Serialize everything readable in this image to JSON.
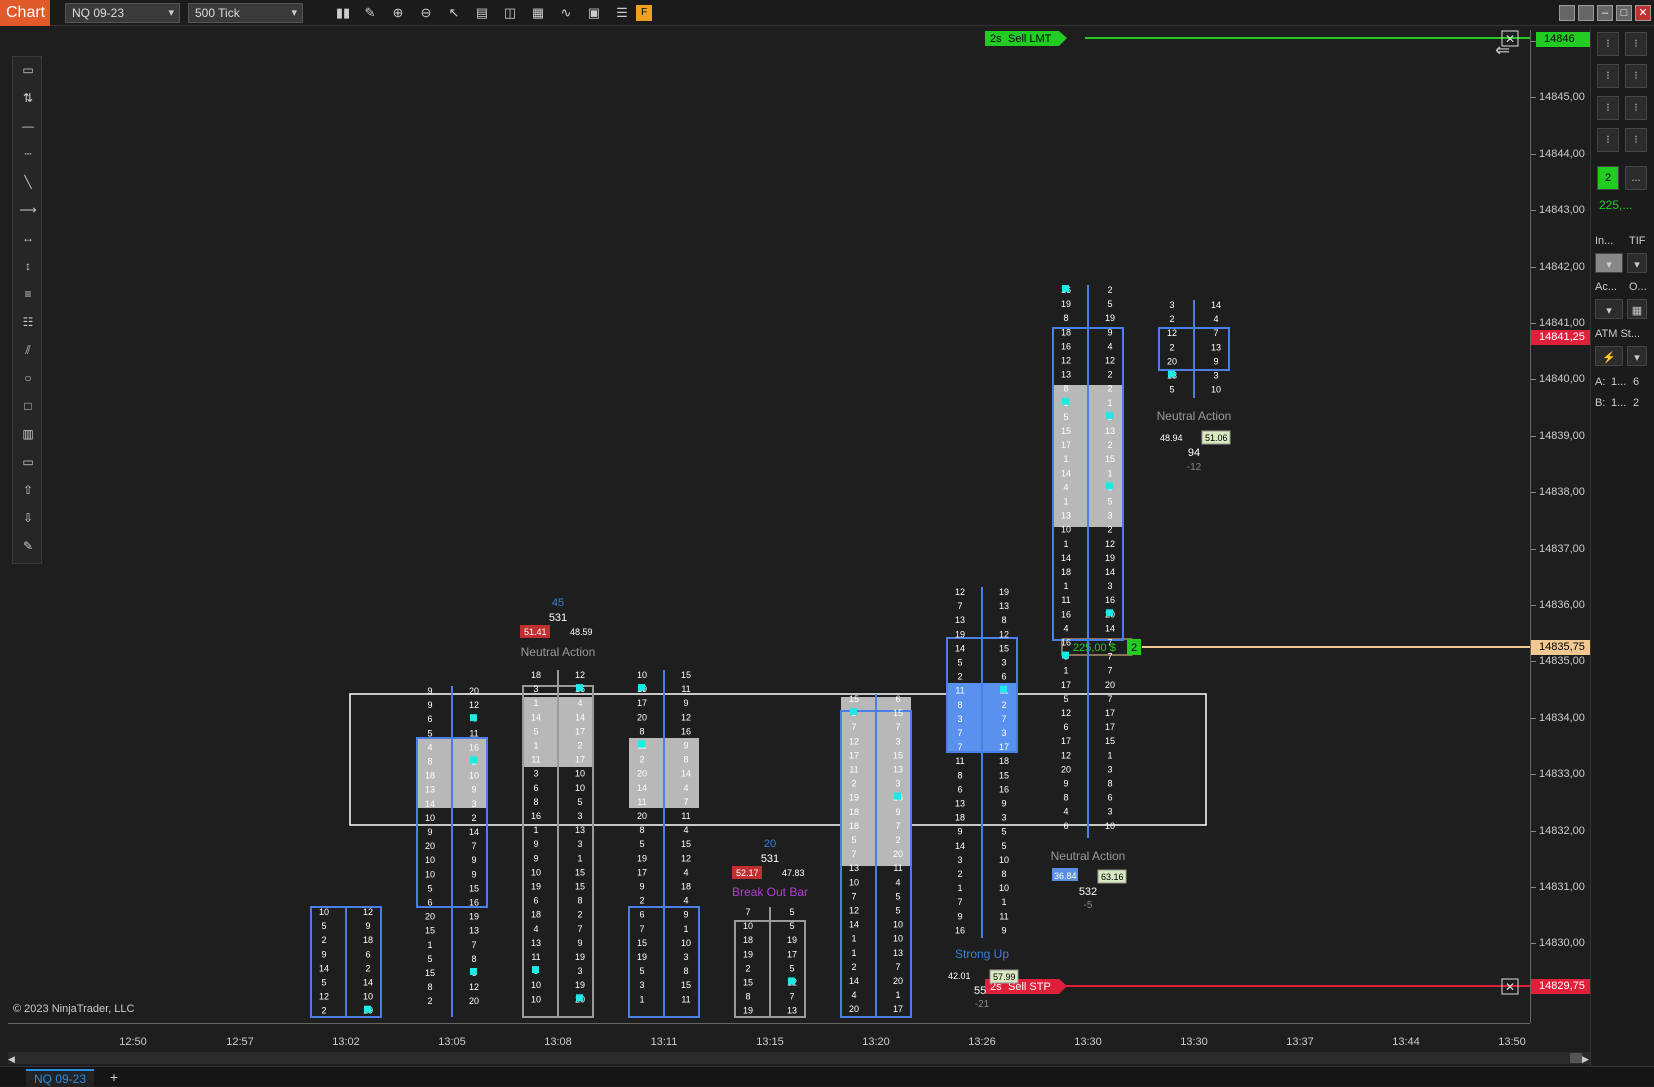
{
  "app": {
    "title": "Chart"
  },
  "toolbar": {
    "instrument": "NQ 09-23",
    "interval": "500 Tick",
    "icons": [
      "bar-type-icon",
      "pencil-icon",
      "zoom-in-icon",
      "zoom-out-icon",
      "pointer-icon",
      "data-box-icon",
      "properties-icon",
      "strategies-icon",
      "indicators-icon",
      "chart-trader-icon",
      "list-icon",
      "f-icon"
    ],
    "f_label": "F"
  },
  "window_controls": [
    "restore-icon",
    "tile-icon",
    "minimize-icon",
    "maximize-icon",
    "close-icon"
  ],
  "drawing_tools": [
    "ruler-icon",
    "risk-reward-icon",
    "line-icon",
    "ray-icon",
    "extended-line-icon",
    "arrow-line-icon",
    "horizontal-line-icon",
    "vertical-line-icon",
    "fibonacci-icon",
    "fibonacci-extension-icon",
    "channel-icon",
    "ellipse-icon",
    "rectangle-icon",
    "region-icon",
    "text-icon",
    "arrow-up-icon",
    "arrow-down-icon",
    "pencil-icon"
  ],
  "price_axis": {
    "labels": [
      "14846,00",
      "14845,00",
      "14844,00",
      "14843,00",
      "14842,00",
      "14841,00",
      "14840,00",
      "14839,00",
      "14838,00",
      "14837,00",
      "14836,00",
      "14835,00",
      "14834,00",
      "14833,00",
      "14832,00",
      "14831,00",
      "14830,00"
    ],
    "marker_top": "14846",
    "marker_red": "14841,25",
    "marker_last": "14835,75",
    "marker_bottom": "14829,75"
  },
  "time_axis": {
    "labels": [
      "12:50",
      "12:57",
      "13:02",
      "13:05",
      "13:08",
      "13:11",
      "13:15",
      "13:20",
      "13:26",
      "13:30",
      "13:30",
      "13:37",
      "13:44",
      "13:50"
    ]
  },
  "orders": {
    "sell_limit": {
      "qty": "2s",
      "label": "Sell LMT"
    },
    "sell_stop": {
      "qty": "2s",
      "label": "Sell STP"
    },
    "position_pnl": "225,00 $",
    "position_qty": "2"
  },
  "annotations": {
    "neutral_1": "Neutral Action",
    "neutral_2": "Neutral Action",
    "neutral_3": "Neutral Action",
    "breakout": "Break Out Bar",
    "strong_up": "Strong Up"
  },
  "bar_stats": {
    "b1": {
      "delta": "45",
      "volume": "531",
      "left": "51.41",
      "right": "48.59"
    },
    "b2": {
      "delta": "20",
      "volume": "531",
      "left": "52.17",
      "right": "47.83"
    },
    "b3": {
      "left": "42.01",
      "volume": "55",
      "right": "57.99",
      "sub": "-21"
    },
    "b4": {
      "left": "36.84",
      "right": "63.16",
      "volume": "532",
      "sub": "-5"
    },
    "b5": {
      "left": "48.94",
      "right": "51.06",
      "volume": "94",
      "sub": "-12"
    }
  },
  "side_panel": {
    "qty": "2",
    "more": "...",
    "pnl": "225,...",
    "instrument_label": "In...",
    "tif_label": "TIF",
    "account_label": "Ac...",
    "oco_label": "O...",
    "atm_label": "ATM St...",
    "ask_label": "A:",
    "ask_value": "1...",
    "ask_size": "6",
    "bid_label": "B:",
    "bid_value": "1...",
    "bid_size": "2",
    "colors": {
      "green": "#22cc22",
      "red": "#e0203a",
      "position": "#f0c890"
    }
  },
  "footer": {
    "copyright": "© 2023 NinjaTrader, LLC",
    "tab": "NQ 09-23",
    "add": "+"
  }
}
